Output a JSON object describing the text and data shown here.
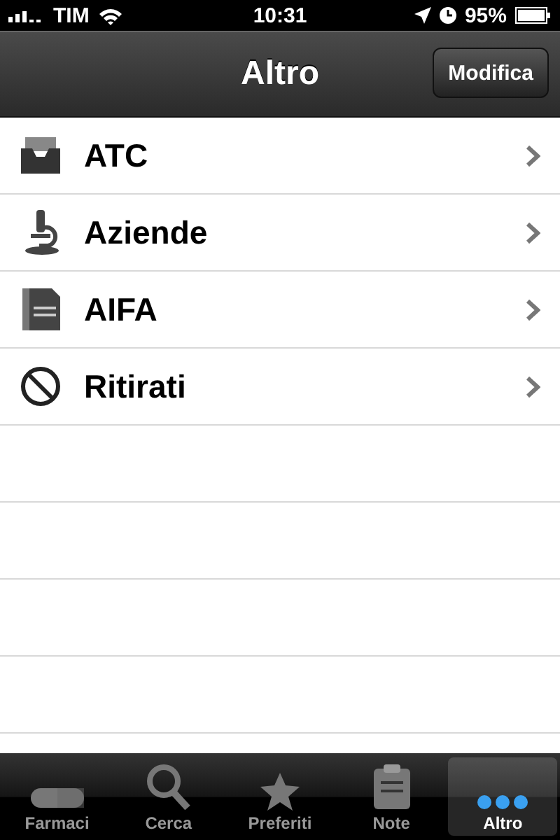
{
  "status_bar": {
    "carrier": "TIM",
    "time": "10:31",
    "battery": "95%"
  },
  "nav_bar": {
    "title": "Altro",
    "button": "Modifica"
  },
  "items": [
    {
      "label": "ATC",
      "kind": "tray"
    },
    {
      "label": "Aziende",
      "kind": "microscope"
    },
    {
      "label": "AIFA",
      "kind": "document"
    },
    {
      "label": "Ritirati",
      "kind": "prohibited"
    }
  ],
  "tabs": [
    {
      "label": "Farmaci",
      "kind": "pill",
      "selected": false
    },
    {
      "label": "Cerca",
      "kind": "search",
      "selected": false
    },
    {
      "label": "Preferiti",
      "kind": "star",
      "selected": false
    },
    {
      "label": "Note",
      "kind": "clipboard",
      "selected": false
    },
    {
      "label": "Altro",
      "kind": "more",
      "selected": true
    }
  ]
}
